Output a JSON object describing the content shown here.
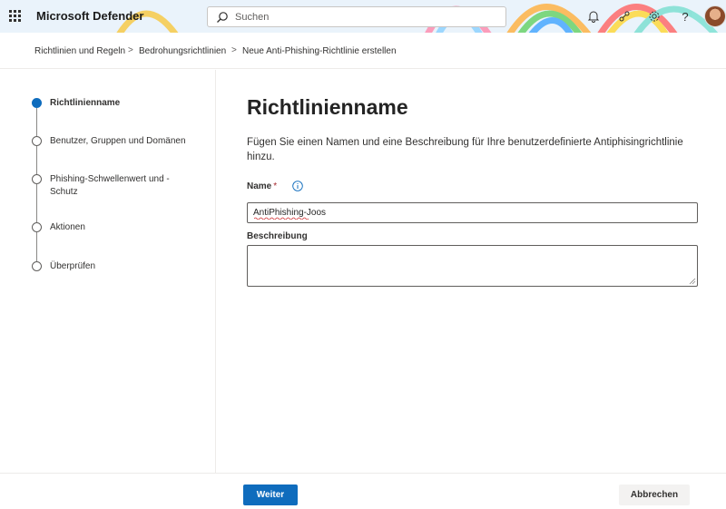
{
  "app": {
    "title": "Microsoft Defender"
  },
  "header": {
    "search_placeholder": "Suchen",
    "icons": [
      "waffle-icon",
      "search-icon",
      "bell-icon",
      "connect-icon",
      "gear-icon",
      "help-icon",
      "avatar"
    ]
  },
  "breadcrumb": {
    "items": [
      "Richtlinien und Regeln",
      "Bedrohungsrichtlinien",
      "Neue Anti-Phishing-Richtlinie erstellen"
    ],
    "separator": ">"
  },
  "steps": [
    {
      "label": "Richtlinienname",
      "active": true
    },
    {
      "label": "Benutzer, Gruppen und Domänen",
      "active": false
    },
    {
      "label_line1": "Phishing-Schwellenwert und -",
      "label_line2": "Schutz",
      "active": false
    },
    {
      "label": "Aktionen",
      "active": false
    },
    {
      "label": "Überprüfen",
      "active": false
    }
  ],
  "form": {
    "title": "Richtlinienname",
    "description": "Fügen Sie einen Namen und eine Beschreibung für Ihre benutzerdefinierte Antiphisingrichtlinie hinzu.",
    "name_label": "Name",
    "required_marker": "*",
    "name_value": "AntiPhishing-Joos",
    "description_label": "Beschreibung",
    "description_value": ""
  },
  "footer": {
    "next_label": "Weiter",
    "cancel_label": "Abbrechen"
  },
  "colors": {
    "accent": "#0f6cbd",
    "required": "#a4262c"
  }
}
